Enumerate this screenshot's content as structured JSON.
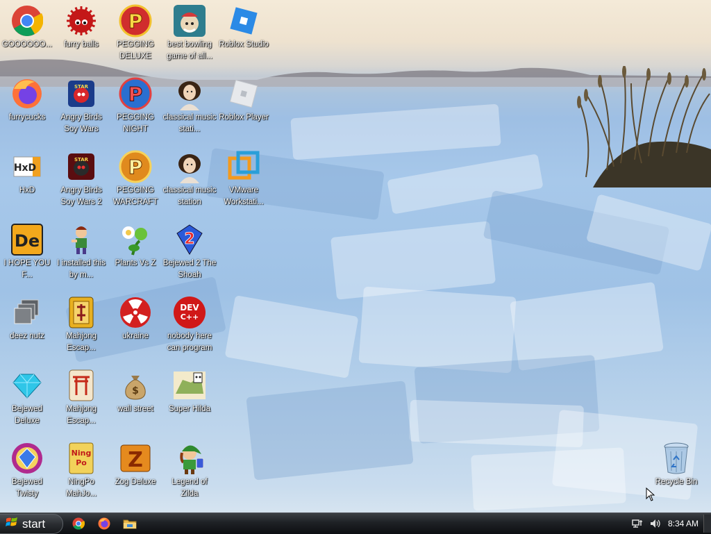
{
  "desktop": {
    "icons": [
      {
        "label": "GOOOOOO...",
        "icon": "chrome-icon"
      },
      {
        "label": "furry balls",
        "icon": "furry-ball-icon"
      },
      {
        "label": "PEGGING DELUXE",
        "icon": "pegging-icon"
      },
      {
        "label": "best bowling game of all...",
        "icon": "bowling-icon"
      },
      {
        "label": "Roblox Studio",
        "icon": "roblox-studio-icon"
      },
      {
        "label": "furrycucks",
        "icon": "firefox-icon"
      },
      {
        "label": "Angry Birds Soy Wars",
        "icon": "angry-birds-icon"
      },
      {
        "label": "PEGGING NIGHT",
        "icon": "pegging-night-icon"
      },
      {
        "label": "classical music stati...",
        "icon": "classical-portrait-icon"
      },
      {
        "label": "Roblox Player",
        "icon": "roblox-player-icon"
      },
      {
        "label": "HxD",
        "icon": "hxd-icon"
      },
      {
        "label": "Angry Birds Soy Wars 2",
        "icon": "angry-birds-2-icon"
      },
      {
        "label": "PEGGING WARCRAFT",
        "icon": "pegging-warcraft-icon"
      },
      {
        "label": "classical music station",
        "icon": "classical-portrait-icon"
      },
      {
        "label": "VMware Workstati...",
        "icon": "vmware-icon"
      },
      {
        "label": "I HOPE YOU F...",
        "icon": "de-icon"
      },
      {
        "label": "I installed this by m...",
        "icon": "character-icon"
      },
      {
        "label": "Plants Vs Z",
        "icon": "plants-icon"
      },
      {
        "label": "Bejewed 2 The Shoah",
        "icon": "bejeweled-2-icon"
      },
      {
        "label": "deez nutz",
        "icon": "windows-stack-icon"
      },
      {
        "label": "Mahjong Escap...",
        "icon": "mahjong-tile-icon"
      },
      {
        "label": "ukraine",
        "icon": "radiation-icon"
      },
      {
        "label": "nobody here can program",
        "icon": "devcpp-icon"
      },
      {
        "label": "Bejewed Deluxe",
        "icon": "diamond-icon"
      },
      {
        "label": "Mahjong Escap...",
        "icon": "mahjong-gate-icon"
      },
      {
        "label": "wall street",
        "icon": "money-bag-icon"
      },
      {
        "label": "Super Hilda",
        "icon": "super-hilda-icon"
      },
      {
        "label": "Bejewed Twisty",
        "icon": "bejeweled-twist-icon"
      },
      {
        "label": "NingPo MahJo...",
        "icon": "ningpo-icon"
      },
      {
        "label": "Zog Deluxe",
        "icon": "zog-icon"
      },
      {
        "label": "Legend of Zilda",
        "icon": "zelda-icon"
      }
    ],
    "recycle_bin": {
      "label": "Recycle Bin",
      "icon": "recycle-bin-icon"
    }
  },
  "icon_glyphs": {
    "ningpo": "Ning Po",
    "devcpp": "DEV C++",
    "bejeweled2": "2",
    "de": "De",
    "hxd": "HxD",
    "pegging": "P"
  },
  "taskbar": {
    "start_label": "start",
    "quick_launch": [
      "chrome-icon",
      "firefox-icon",
      "folder-icon"
    ],
    "tray": {
      "clock": "8:34 AM",
      "icons": [
        "network-icon",
        "volume-icon"
      ]
    }
  },
  "colors": {
    "taskbar": "#1e2125",
    "label_text": "#ffffff"
  }
}
